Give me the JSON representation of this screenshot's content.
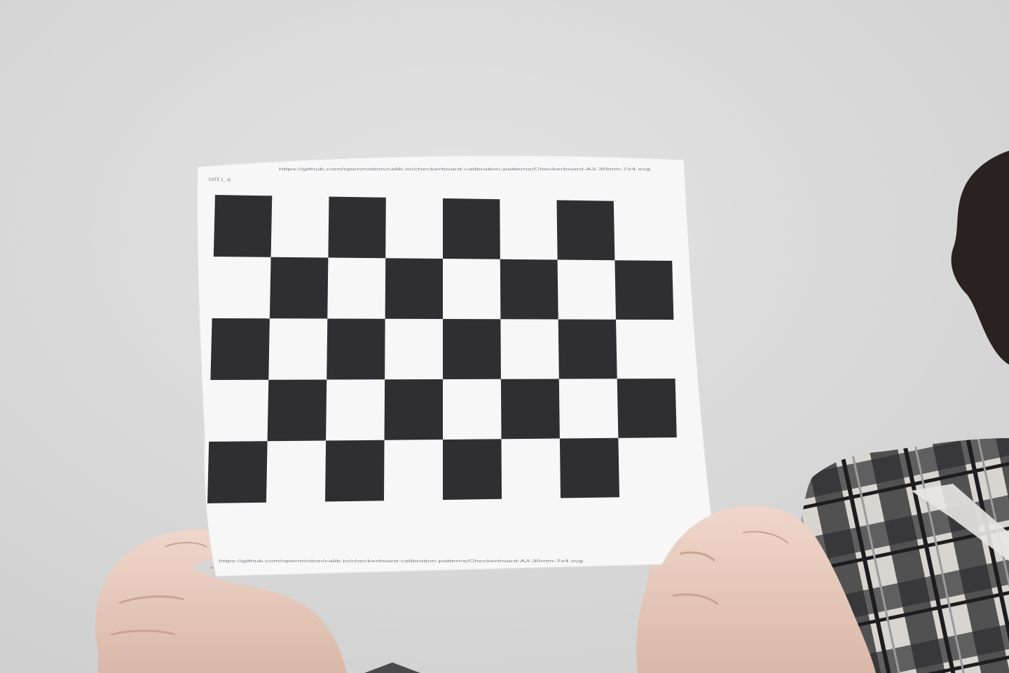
{
  "photo": {
    "subject": "handheld printed calibration chessboard",
    "board": {
      "rows": 5,
      "cols": 8,
      "dark_color": "#2f2f31",
      "light_color": "#f6f6f6"
    },
    "paper_color": "#f7f7f7",
    "wall_color": "#dcdcdc",
    "header_left_text": "DATE 1_ a)",
    "header_url_text": "https://github.com/openmotion/calib.io/checkerboard-calibration-patterns/Checkerboard-A3-30mm-7x4.svg",
    "footer_url_text": "https://github.com/openmotion/calib.io/checkerboard-calibration-patterns/Checkerboard-A3-30mm-7x4.svg"
  }
}
